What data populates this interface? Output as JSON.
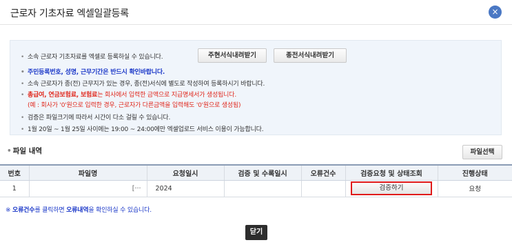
{
  "dialog": {
    "title": "근로자 기초자료 엑셀일괄등록",
    "close_icon": "×"
  },
  "info": {
    "bullet": "•",
    "line1": "소속 근로자 기초자료를 엑셀로 등록하실 수 있습니다.",
    "btn_current_form": "주현서식내려받기",
    "btn_prev_form": "종전서식내려받기",
    "line2": "주민등록번호, 성명, 근무기간은 반드시 확인바랍니다.",
    "line3": "소속 근로자가 종(전) 근무지가 있는 경우, 종(전)서식에 별도로 작성하여 등록하시기 바랍니다.",
    "line4_bold": "총급여, 연금보험료, 보험료",
    "line4_rest": "는 회사에서 입력한 금액으로 지급명세서가 생성됩니다.",
    "line4_sub": "(예 : 회사가 '0'원으로 입력한 경우, 근로자가 다른금액을 입력해도 '0'원으로 생성됨)",
    "line5": "검증은 파일크기에 따라서 시간이 다소 걸릴 수 있습니다.",
    "line6": "1월 20일 ~ 1월 25일 사이에는 19:00 ~ 24:00에만 엑셀업로드 서비스 이용이 가능합니다."
  },
  "file_section": {
    "bullet": "•",
    "title": "파일 내역",
    "select_button": "파일선택"
  },
  "table": {
    "headers": [
      "번호",
      "파일명",
      "요청일시",
      "검증 및 수록일시",
      "오류건수",
      "검증요청 및 상태조회",
      "진행상태"
    ],
    "rows": [
      {
        "no": "1",
        "filename": "[···",
        "requested": "2024",
        "verified": "",
        "errors": "",
        "action": "검증하기",
        "status": "요청"
      }
    ]
  },
  "note": {
    "prefix": "※ ",
    "link1": "오류건수",
    "mid": "를 클릭하면 ",
    "link2": "오류내역",
    "suffix": "을 확인하실 수 있습니다."
  },
  "footer": {
    "close_button": "닫기"
  }
}
